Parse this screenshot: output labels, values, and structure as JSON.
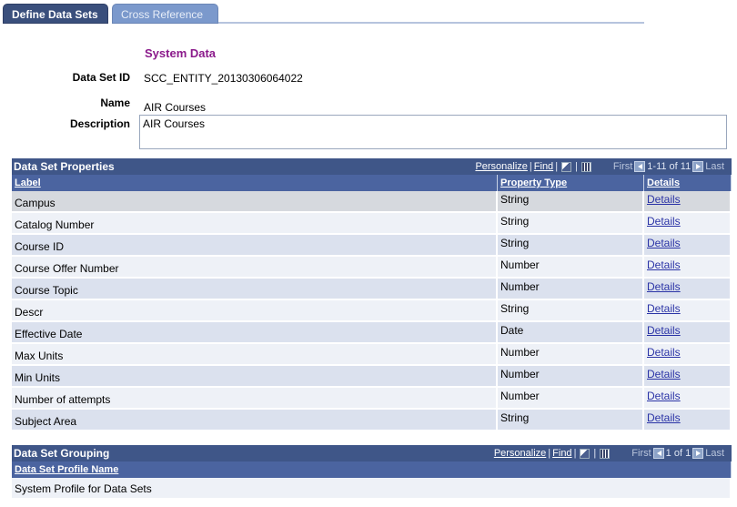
{
  "tabs": [
    {
      "label": "Define Data Sets",
      "active": true
    },
    {
      "label": "Cross Reference",
      "active": false
    }
  ],
  "header": {
    "section_title": "System Data",
    "data_set_id_label": "Data Set ID",
    "data_set_id_value": "SCC_ENTITY_20130306064022",
    "name_label": "Name",
    "name_value": "AIR Courses",
    "description_label": "Description",
    "description_value": "AIR Courses"
  },
  "properties_grid": {
    "title": "Data Set Properties",
    "personalize": "Personalize",
    "find": "Find",
    "sep": "|",
    "first": "First",
    "range": "1-11 of 11",
    "last": "Last",
    "columns": [
      "Label",
      "Property Type",
      "Details"
    ],
    "rows": [
      {
        "label": "Campus",
        "type": "String",
        "details": "Details"
      },
      {
        "label": "Catalog Number",
        "type": "String",
        "details": "Details"
      },
      {
        "label": "Course ID",
        "type": "String",
        "details": "Details"
      },
      {
        "label": "Course Offer Number",
        "type": "Number",
        "details": "Details"
      },
      {
        "label": "Course Topic",
        "type": "Number",
        "details": "Details"
      },
      {
        "label": "Descr",
        "type": "String",
        "details": "Details"
      },
      {
        "label": "Effective Date",
        "type": "Date",
        "details": "Details"
      },
      {
        "label": "Max Units",
        "type": "Number",
        "details": "Details"
      },
      {
        "label": "Min Units",
        "type": "Number",
        "details": "Details"
      },
      {
        "label": "Number of attempts",
        "type": "Number",
        "details": "Details"
      },
      {
        "label": "Subject Area",
        "type": "String",
        "details": "Details"
      }
    ]
  },
  "grouping_grid": {
    "title": "Data Set Grouping",
    "personalize": "Personalize",
    "find": "Find",
    "sep": "|",
    "first": "First",
    "range": "1 of 1",
    "last": "Last",
    "columns": [
      "Data Set Profile Name"
    ],
    "rows": [
      {
        "name": "System Profile for Data Sets"
      }
    ]
  },
  "icons": {
    "zoom": "zoom-grid-icon",
    "grid": "view-all-grid-icon",
    "prev": "prev-arrow-icon",
    "next": "next-arrow-icon"
  },
  "colors": {
    "header_bg": "#3f5688",
    "colhead_bg": "#4b64a0",
    "row_odd": "#dbe1ee",
    "row_even": "#eef1f7",
    "accent_title": "#8b1a8b",
    "link": "#2a33a6"
  }
}
